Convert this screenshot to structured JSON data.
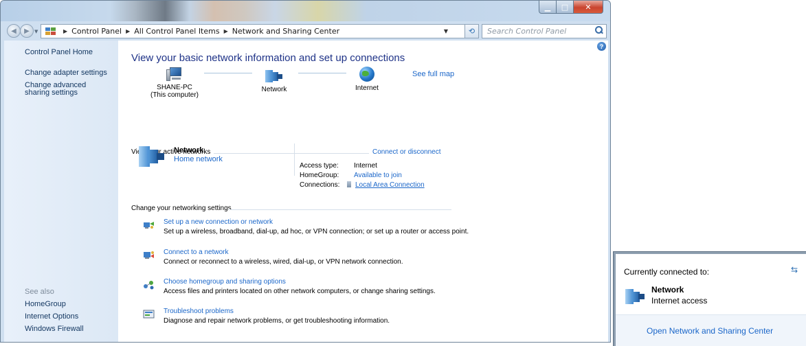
{
  "window": {
    "breadcrumb": [
      "Control Panel",
      "All Control Panel Items",
      "Network and Sharing Center"
    ],
    "search_placeholder": "Search Control Panel"
  },
  "sidebar": {
    "home": "Control Panel Home",
    "links": [
      "Change adapter settings",
      "Change advanced sharing settings"
    ],
    "see_also_label": "See also",
    "see_also": [
      "HomeGroup",
      "Internet Options",
      "Windows Firewall"
    ]
  },
  "main": {
    "title": "View your basic network information and set up connections",
    "see_full_map": "See full map",
    "map": {
      "computer_name": "SHANE-PC",
      "computer_sub": "(This computer)",
      "network_label": "Network",
      "internet_label": "Internet"
    },
    "active_networks": {
      "label": "View your active networks",
      "connect_link": "Connect or disconnect",
      "name": "Network",
      "type": "Home network",
      "access_type_label": "Access type:",
      "access_type_value": "Internet",
      "homegroup_label": "HomeGroup:",
      "homegroup_value": "Available to join",
      "connections_label": "Connections:",
      "connections_value": "Local Area Connection"
    },
    "settings_label": "Change your networking settings",
    "tasks": [
      {
        "title": "Set up a new connection or network",
        "desc": "Set up a wireless, broadband, dial-up, ad hoc, or VPN connection; or set up a router or access point."
      },
      {
        "title": "Connect to a network",
        "desc": "Connect or reconnect to a wireless, wired, dial-up, or VPN network connection."
      },
      {
        "title": "Choose homegroup and sharing options",
        "desc": "Access files and printers located on other network computers, or change sharing settings."
      },
      {
        "title": "Troubleshoot problems",
        "desc": "Diagnose and repair network problems, or get troubleshooting information."
      }
    ]
  },
  "flyout": {
    "title": "Currently connected to:",
    "network_name": "Network",
    "network_status": "Internet access",
    "open_link": "Open Network and Sharing Center"
  },
  "icons": {
    "back": "back-arrow-icon",
    "forward": "forward-arrow-icon",
    "refresh": "refresh-icon",
    "search": "search-icon",
    "help": "help-icon"
  }
}
